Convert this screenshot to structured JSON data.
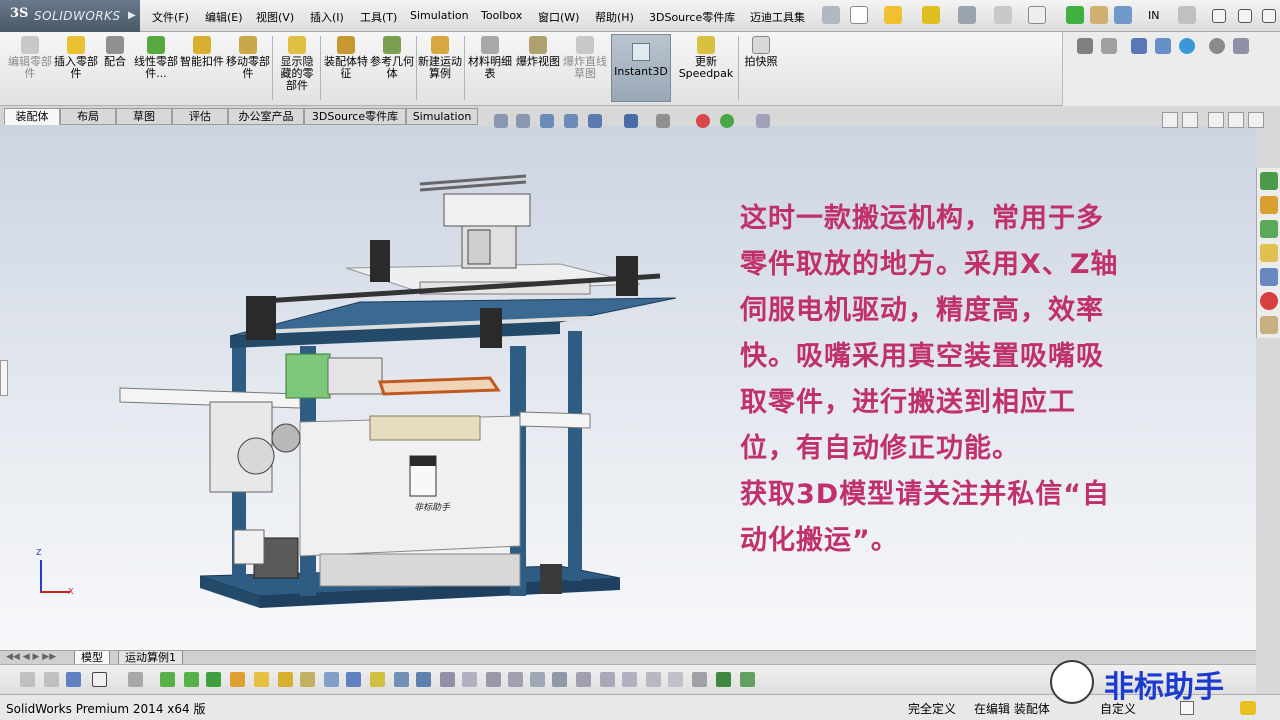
{
  "app": {
    "logo_text": "SOLIDWORKS",
    "menu": [
      "文件(F)",
      "编辑(E)",
      "视图(V)",
      "插入(I)",
      "工具(T)",
      "Simulation",
      "Toolbox",
      "窗口(W)",
      "帮助(H)",
      "3DSource零件库",
      "迈迪工具集"
    ],
    "search_label": "IN"
  },
  "command_manager": {
    "buttons": [
      {
        "label": "编辑零部件",
        "disabled": true
      },
      {
        "label": "插入零部件",
        "disabled": false
      },
      {
        "label": "配合",
        "disabled": false
      },
      {
        "label": "线性零部件...",
        "disabled": false
      },
      {
        "label": "智能扣件",
        "disabled": false
      },
      {
        "label": "移动零部件",
        "disabled": false
      },
      {
        "label": "显示隐藏的零部件",
        "disabled": false
      },
      {
        "label": "装配体特征",
        "disabled": false
      },
      {
        "label": "参考几何体",
        "disabled": false
      },
      {
        "label": "新建运动算例",
        "disabled": false
      },
      {
        "label": "材料明细表",
        "disabled": false
      },
      {
        "label": "爆炸视图",
        "disabled": false
      },
      {
        "label": "爆炸直线草图",
        "disabled": true
      }
    ],
    "instant3d": "Instant3D",
    "speedpak": {
      "line1": "更新",
      "line2": "Speedpak"
    },
    "snapshot": "拍快照"
  },
  "tabs": [
    "装配体",
    "布局",
    "草图",
    "评估",
    "办公室产品",
    "3DSource零件库",
    "Simulation"
  ],
  "active_tab": "装配体",
  "overlay": {
    "lines": [
      "这时一款搬运机构，常用于多",
      "零件取放的地方。采用X、Z轴",
      "伺服电机驱动，精度高，效率",
      "快。吸嘴采用真空装置吸嘴吸",
      "取零件，进行搬送到相应工",
      "位，有自动修正功能。",
      "获取3D模型请关注并私信“自",
      "动化搬运”。"
    ]
  },
  "triad": {
    "z": "Z",
    "x": "X"
  },
  "plate_label": "非标助手",
  "bottom_tabs": [
    "模型",
    "运动算例1"
  ],
  "status": {
    "product": "SolidWorks Premium 2014 x64 版",
    "defined": "完全定义",
    "editing": "在编辑 装配体",
    "custom": "自定义"
  },
  "watermark": "非标助手",
  "colors": {
    "overlay_text": "#c0306a",
    "frame_blue": "#2e5c82",
    "watermark_text": "#1a3ad0"
  }
}
